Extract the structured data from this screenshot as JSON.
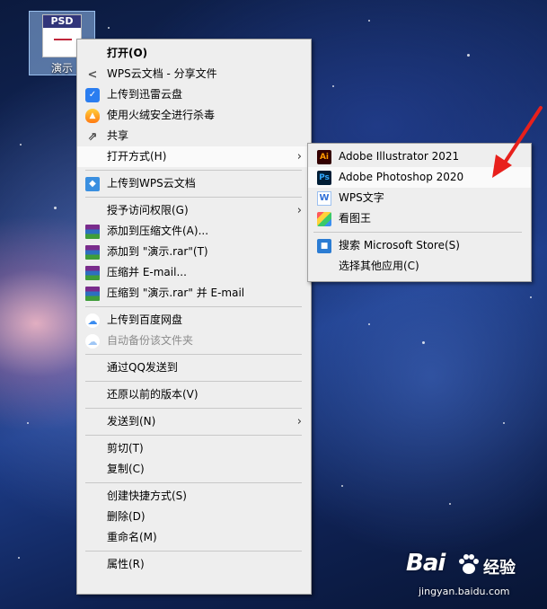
{
  "desktop_icon": {
    "thumbnail_tag": "PSD",
    "label": "演示"
  },
  "context_menu": {
    "items": [
      {
        "label": "打开(O)",
        "icon": null
      },
      {
        "label": "WPS云文档 - 分享文件",
        "icon": "share-nodes-icon"
      },
      {
        "label": "上传到迅雷云盘",
        "icon": "xunlei-icon"
      },
      {
        "label": "使用火绒安全进行杀毒",
        "icon": "huorong-icon"
      },
      {
        "label": "共享",
        "icon": "share-icon"
      },
      {
        "label": "打开方式(H)",
        "icon": null
      },
      {
        "label": "上传到WPS云文档",
        "icon": "wps-cloud-icon"
      },
      {
        "label": "授予访问权限(G)",
        "icon": null
      },
      {
        "label": "添加到压缩文件(A)...",
        "icon": "winrar-icon"
      },
      {
        "label": "添加到 \"演示.rar\"(T)",
        "icon": "winrar-icon"
      },
      {
        "label": "压缩并 E-mail...",
        "icon": "winrar-icon"
      },
      {
        "label": "压缩到 \"演示.rar\" 并 E-mail",
        "icon": "winrar-icon"
      },
      {
        "label": "上传到百度网盘",
        "icon": "baidu-netdisk-icon"
      },
      {
        "label": "自动备份该文件夹",
        "icon": "baidu-netdisk-icon"
      },
      {
        "label": "通过QQ发送到",
        "icon": null
      },
      {
        "label": "还原以前的版本(V)",
        "icon": null
      },
      {
        "label": "发送到(N)",
        "icon": null
      },
      {
        "label": "剪切(T)",
        "icon": null
      },
      {
        "label": "复制(C)",
        "icon": null
      },
      {
        "label": "创建快捷方式(S)",
        "icon": null
      },
      {
        "label": "删除(D)",
        "icon": null
      },
      {
        "label": "重命名(M)",
        "icon": null
      },
      {
        "label": "属性(R)",
        "icon": null
      }
    ]
  },
  "open_with_submenu": {
    "items": [
      {
        "label": "Adobe Illustrator 2021",
        "icon": "illustrator-icon",
        "glyph": "Ai"
      },
      {
        "label": "Adobe Photoshop 2020",
        "icon": "photoshop-icon",
        "glyph": "Ps"
      },
      {
        "label": "WPS文字",
        "icon": "wps-writer-icon",
        "glyph": "W"
      },
      {
        "label": "看图王",
        "icon": "image-viewer-icon",
        "glyph": ""
      },
      {
        "label": "搜索 Microsoft Store(S)",
        "icon": "microsoft-store-icon",
        "glyph": "■"
      },
      {
        "label": "选择其他应用(C)",
        "icon": null,
        "glyph": ""
      }
    ]
  },
  "watermark": {
    "logo": "Bai",
    "logo2": "经验",
    "url": "jingyan.baidu.com"
  },
  "colors": {
    "menu_bg": "#eeeeee",
    "highlight_bg": "#fafafa",
    "annotation_arrow": "#e8201c"
  }
}
